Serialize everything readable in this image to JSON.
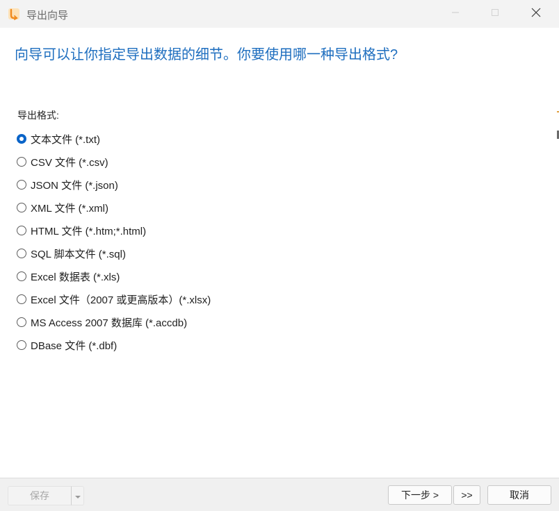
{
  "window": {
    "title": "导出向导"
  },
  "wizard": {
    "question": "向导可以让你指定导出数据的细节。你要使用哪一种导出格式?",
    "format_label": "导出格式:",
    "selected_index": 0,
    "options": [
      {
        "label": "文本文件 (*.txt)",
        "checked": true
      },
      {
        "label": "CSV 文件 (*.csv)",
        "checked": false
      },
      {
        "label": "JSON 文件 (*.json)",
        "checked": false
      },
      {
        "label": "XML 文件 (*.xml)",
        "checked": false
      },
      {
        "label": "HTML 文件 (*.htm;*.html)",
        "checked": false
      },
      {
        "label": "SQL 脚本文件 (*.sql)",
        "checked": false
      },
      {
        "label": "Excel 数据表 (*.xls)",
        "checked": false
      },
      {
        "label": "Excel 文件（2007 或更高版本）(*.xlsx)",
        "checked": false
      },
      {
        "label": "MS Access 2007 数据库 (*.accdb)",
        "checked": false
      },
      {
        "label": "DBase 文件 (*.dbf)",
        "checked": false
      }
    ]
  },
  "footer": {
    "save_label": "保存",
    "next_label": "下一步 >",
    "last_label": ">>",
    "cancel_label": "取消"
  },
  "colors": {
    "accent": "#0a64c8",
    "question_text": "#1e6ebf",
    "app_icon": "#f5a623"
  },
  "icons": {
    "app": "navicat-export-icon",
    "minimize": "minimize-icon",
    "maximize": "maximize-icon",
    "close": "close-icon",
    "dropdown": "chevron-down-icon"
  }
}
